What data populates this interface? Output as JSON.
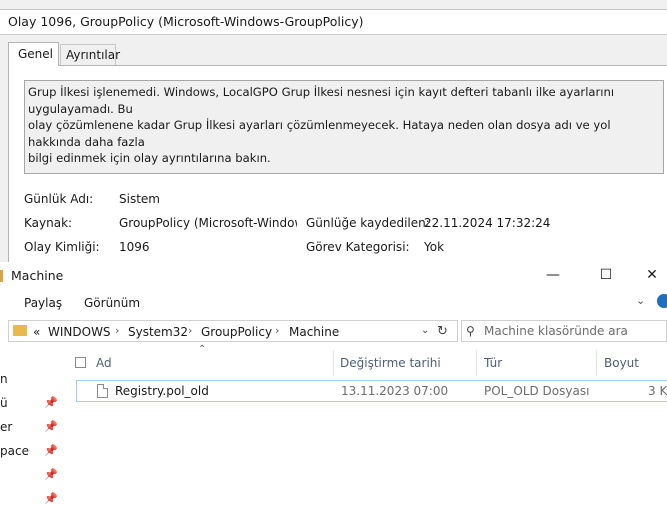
{
  "event_viewer": {
    "title": "Olay 1096, GroupPolicy (Microsoft-Windows-GroupPolicy)",
    "tabs": [
      "Genel",
      "Ayrıntılar"
    ],
    "description_lines": [
      "Grup İlkesi işlenemedi. Windows, LocalGPO Grup İlkesi nesnesi için kayıt defteri tabanlı ilke ayarlarını uygulayamadı. Bu",
      "olay çözümlenene kadar Grup İlkesi ayarları çözümlenmeyecek. Hataya neden olan dosya adı ve yol hakkında daha fazla",
      "bilgi edinmek için olay ayrıntılarına bakın."
    ],
    "fields": {
      "log_name_label": "Günlük Adı:",
      "log_name_value": "Sistem",
      "source_label": "Kaynak:",
      "source_value": "GroupPolicy (Microsoft-Windows",
      "logged_label": "Günlüğe kaydedilen:",
      "logged_value": "22.11.2024 17:32:24",
      "event_id_label": "Olay Kimliği:",
      "event_id_value": "1096",
      "task_category_label": "Görev Kategorisi:",
      "task_category_value": "Yok"
    }
  },
  "explorer": {
    "title": "Machine",
    "window_controls": {
      "minimize": "—",
      "maximize": "☐",
      "close": "✕"
    },
    "ribbon_tabs": [
      "Paylaş",
      "Görünüm"
    ],
    "address": {
      "overflow": "«",
      "crumbs": [
        "WINDOWS",
        "System32",
        "GroupPolicy",
        "Machine"
      ]
    },
    "search_placeholder": "Machine klasöründe ara",
    "nav_fragments": [
      "n",
      "ü",
      "er",
      "pace",
      "",
      ""
    ],
    "columns": [
      "Ad",
      "Değiştirme tarihi",
      "Tür",
      "Boyut"
    ],
    "files": [
      {
        "name": "Registry.pol_old",
        "modified": "13.11.2023 07:00",
        "type": "POL_OLD Dosyası",
        "size": "3 K"
      }
    ],
    "icons": [
      "folder-icon",
      "search-icon",
      "refresh-icon",
      "pin-icon",
      "file-icon",
      "help-icon"
    ],
    "colors": {
      "selection_border": "#99d1ff",
      "column_header_text": "#4c607a",
      "help_icon": "#1b6fc4"
    }
  }
}
